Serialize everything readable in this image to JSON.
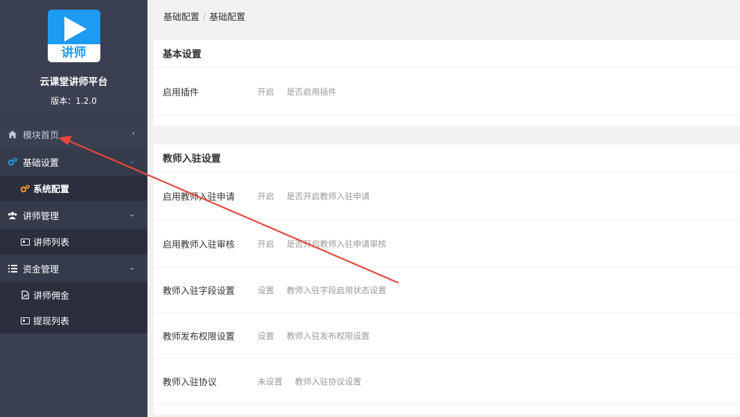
{
  "brand": {
    "logo_text": "讲师",
    "name": "云课堂讲师平台",
    "version": "版本：1.2.0"
  },
  "nav": {
    "home": {
      "label": "模块首页",
      "icon": "home-icon"
    },
    "basic": {
      "label": "基础设置",
      "icon": "cogs-icon",
      "sub": [
        {
          "label": "系统配置",
          "icon": "cogs-icon"
        }
      ]
    },
    "lecturer": {
      "label": "讲师管理",
      "icon": "users-icon",
      "sub": [
        {
          "label": "讲师列表",
          "icon": "card-icon"
        }
      ]
    },
    "finance": {
      "label": "资金管理",
      "icon": "list-icon",
      "sub": [
        {
          "label": "讲师佣金",
          "icon": "chart-file-icon"
        },
        {
          "label": "提现列表",
          "icon": "card-icon"
        }
      ]
    }
  },
  "breadcrumb": {
    "items": [
      "基础配置",
      "基础配置"
    ],
    "sep": "/"
  },
  "cards": [
    {
      "title": "基本设置",
      "rows": [
        {
          "label": "启用插件",
          "value": "开启",
          "desc": "是否启用插件"
        }
      ]
    },
    {
      "title": "教师入驻设置",
      "rows": [
        {
          "label": "启用教师入驻申请",
          "value": "开启",
          "desc": "是否开启教师入驻申请"
        },
        {
          "label": "启用教师入驻审核",
          "value": "开启",
          "desc": "是否开启教师入驻申请审核"
        },
        {
          "label": "教师入驻字段设置",
          "value": "设置",
          "desc": "教师入驻字段启用状态设置"
        },
        {
          "label": "教师发布权限设置",
          "value": "设置",
          "desc": "教师入驻发布权限设置"
        },
        {
          "label": "教师入驻协议",
          "value": "未设置",
          "desc": "教师入驻协议设置"
        }
      ]
    }
  ],
  "colors": {
    "sidebar": "#3a3f51",
    "accent": "#1d9bf0",
    "active_icon": "#ff9a2e",
    "annotation_arrow": "#e8453c"
  }
}
